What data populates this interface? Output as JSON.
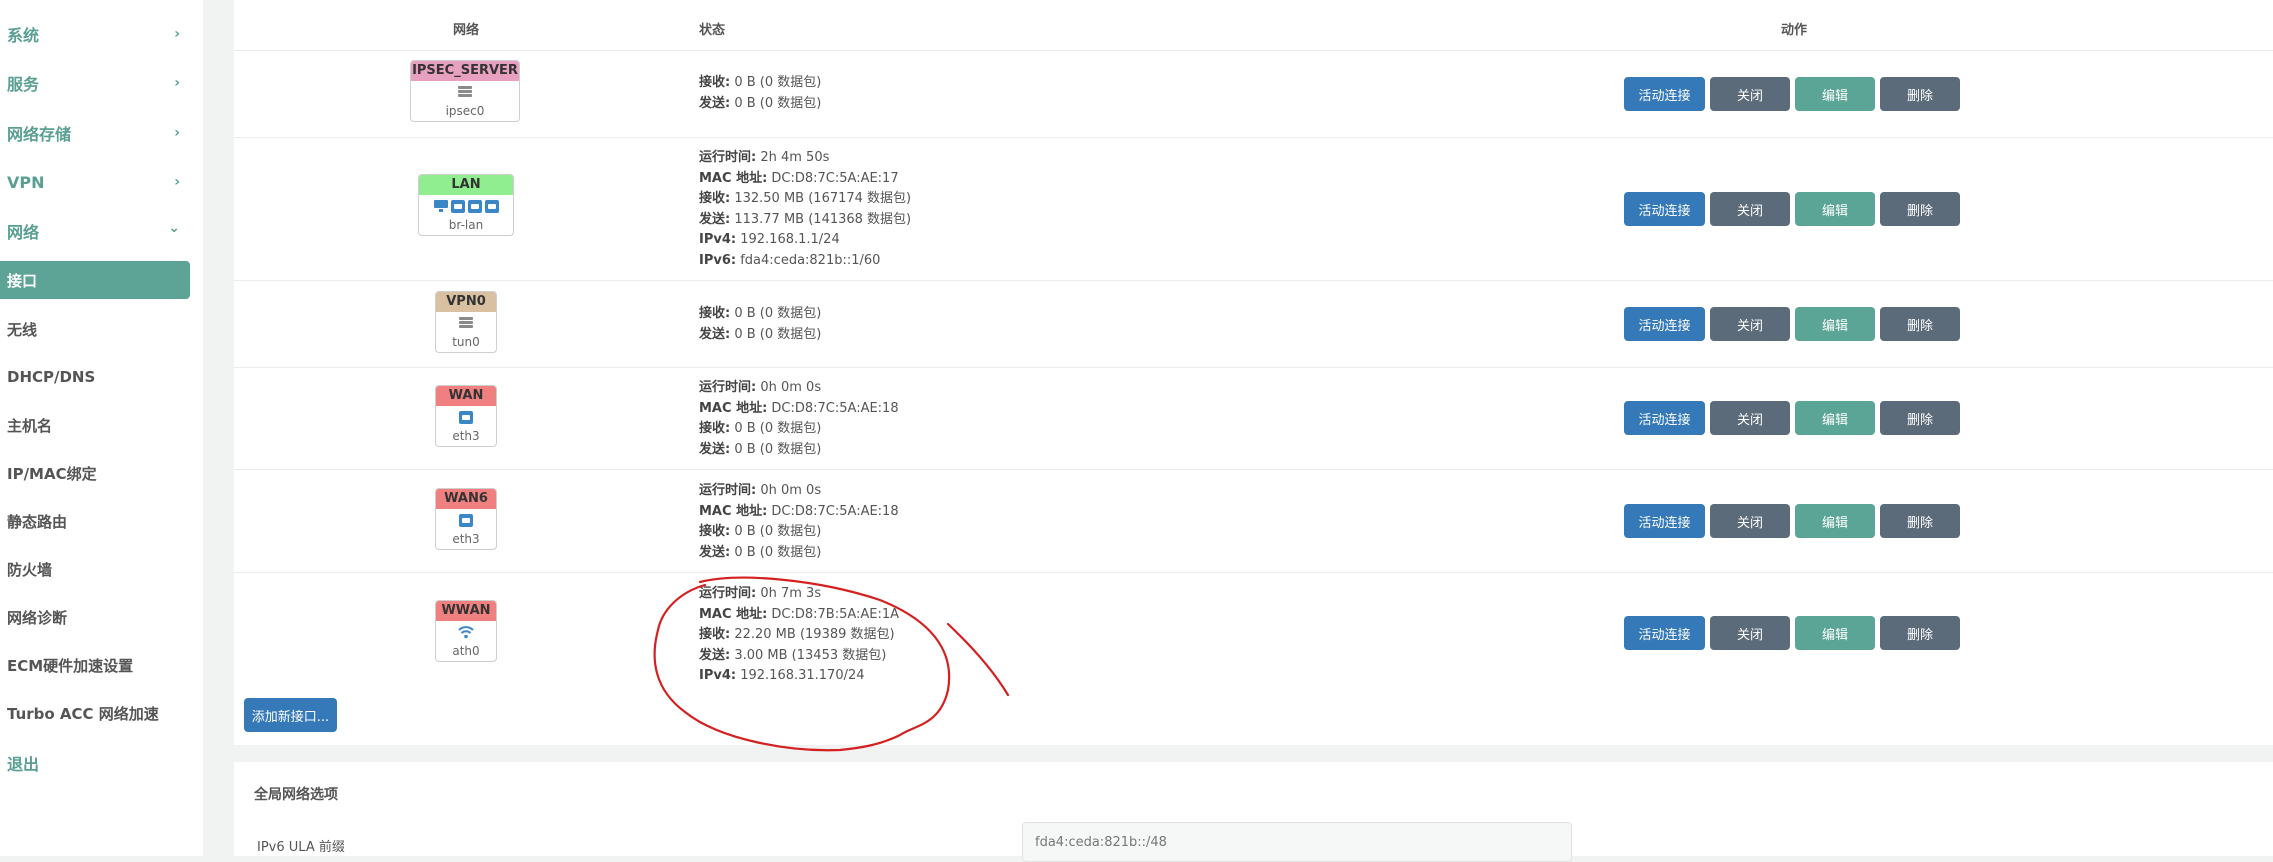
{
  "sidebar": {
    "menus": [
      {
        "label": "系统",
        "chevron": "›"
      },
      {
        "label": "服务",
        "chevron": "›"
      },
      {
        "label": "网络存储",
        "chevron": "›"
      },
      {
        "label": "VPN",
        "chevron": "›"
      },
      {
        "label": "网络",
        "chevron": "⌄"
      }
    ],
    "network_items": [
      "接口",
      "无线",
      "DHCP/DNS",
      "主机名",
      "IP/MAC绑定",
      "静态路由",
      "防火墙",
      "网络诊断",
      "ECM硬件加速设置",
      "Turbo ACC 网络加速"
    ],
    "logout": "退出"
  },
  "table": {
    "headers": {
      "network": "网络",
      "status": "状态",
      "actions": "动作"
    },
    "buttons": {
      "connect": "活动连接",
      "close": "关闭",
      "edit": "编辑",
      "delete": "删除"
    },
    "interfaces": [
      {
        "name": "IPSEC_SERVER",
        "device": "ipsec0",
        "color": "#e8a0c0",
        "status": [
          [
            "接收:",
            " 0 B (0 数据包)"
          ],
          [
            "发送:",
            " 0 B (0 数据包)"
          ]
        ]
      },
      {
        "name": "LAN",
        "device": "br-lan",
        "color": "#90ee90",
        "status": [
          [
            "运行时间:",
            " 2h 4m 50s"
          ],
          [
            "MAC 地址:",
            " DC:D8:7C:5A:AE:17"
          ],
          [
            "接收:",
            " 132.50 MB (167174 数据包)"
          ],
          [
            "发送:",
            " 113.77 MB (141368 数据包)"
          ],
          [
            "IPv4:",
            " 192.168.1.1/24"
          ],
          [
            "IPv6:",
            " fda4:ceda:821b::1/60"
          ]
        ]
      },
      {
        "name": "VPN0",
        "device": "tun0",
        "color": "#d8c0a0",
        "status": [
          [
            "接收:",
            " 0 B (0 数据包)"
          ],
          [
            "发送:",
            " 0 B (0 数据包)"
          ]
        ]
      },
      {
        "name": "WAN",
        "device": "eth3",
        "color": "#f08080",
        "status": [
          [
            "运行时间:",
            " 0h 0m 0s"
          ],
          [
            "MAC 地址:",
            " DC:D8:7C:5A:AE:18"
          ],
          [
            "接收:",
            " 0 B (0 数据包)"
          ],
          [
            "发送:",
            " 0 B (0 数据包)"
          ]
        ]
      },
      {
        "name": "WAN6",
        "device": "eth3",
        "color": "#f08080",
        "status": [
          [
            "运行时间:",
            " 0h 0m 0s"
          ],
          [
            "MAC 地址:",
            " DC:D8:7C:5A:AE:18"
          ],
          [
            "接收:",
            " 0 B (0 数据包)"
          ],
          [
            "发送:",
            " 0 B (0 数据包)"
          ]
        ]
      },
      {
        "name": "WWAN",
        "device": "ath0",
        "color": "#f08080",
        "status": [
          [
            "运行时间:",
            " 0h 7m 3s"
          ],
          [
            "MAC 地址:",
            " DC:D8:7B:5A:AE:1A"
          ],
          [
            "接收:",
            " 22.20 MB (19389 数据包)"
          ],
          [
            "发送:",
            " 3.00 MB (13453 数据包)"
          ],
          [
            "IPv4:",
            " 192.168.31.170/24"
          ]
        ]
      }
    ],
    "add_button": "添加新接口..."
  },
  "global": {
    "title": "全局网络选项",
    "ula_label": "IPv6 ULA 前缀",
    "ula_value": "fda4:ceda:821b::/48"
  },
  "colors": {
    "accent": "#5aa596",
    "primary": "#3579b8",
    "annotation": "#d42020"
  }
}
